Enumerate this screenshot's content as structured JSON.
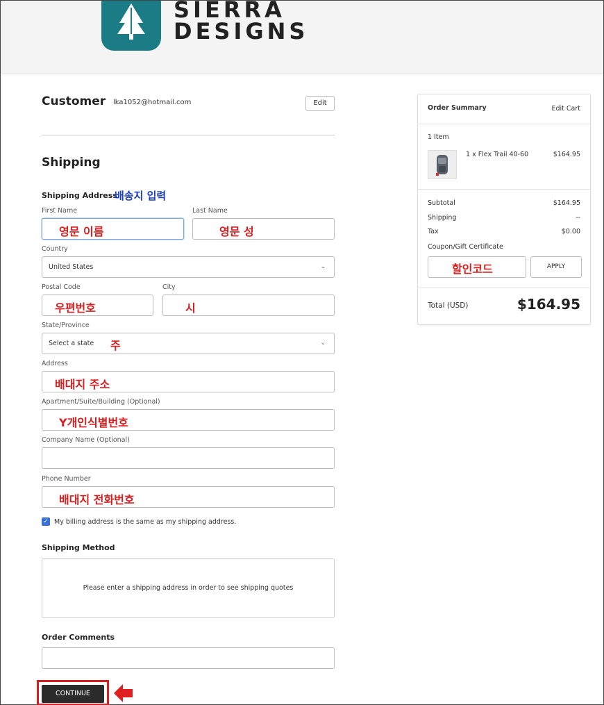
{
  "header": {
    "brand_line1": "SIERRA",
    "brand_line2": "DESIGNS"
  },
  "customer": {
    "title": "Customer",
    "email": "lka1052@hotmail.com",
    "edit_label": "Edit"
  },
  "shipping": {
    "title": "Shipping",
    "address_label": "Shipping Address",
    "address_annotation": "배송지 입력",
    "first_name": {
      "label": "First Name",
      "annotation": "영문 이름"
    },
    "last_name": {
      "label": "Last Name",
      "annotation": "영문 성"
    },
    "country": {
      "label": "Country",
      "value": "United States"
    },
    "postal_code": {
      "label": "Postal Code",
      "annotation": "우편번호"
    },
    "city": {
      "label": "City",
      "annotation": "시"
    },
    "state": {
      "label": "State/Province",
      "value": "Select a state",
      "annotation": "주"
    },
    "address": {
      "label": "Address",
      "annotation": "배대지 주소"
    },
    "apartment": {
      "label": "Apartment/Suite/Building (Optional)",
      "annotation": "Y개인식별번호"
    },
    "company": {
      "label": "Company Name (Optional)"
    },
    "phone": {
      "label": "Phone Number",
      "annotation": "배대지 전화번호"
    },
    "billing_same": "My billing address is the same as my shipping address.",
    "method_title": "Shipping Method",
    "method_text": "Please enter a shipping address in order to see shipping quotes",
    "comments_title": "Order Comments",
    "continue_label": "CONTINUE"
  },
  "summary": {
    "title": "Order Summary",
    "edit_cart": "Edit Cart",
    "item_count": "1 Item",
    "item_name": "1 x Flex Trail 40-60",
    "item_price": "$164.95",
    "subtotal_label": "Subtotal",
    "subtotal_value": "$164.95",
    "shipping_label": "Shipping",
    "shipping_value": "--",
    "tax_label": "Tax",
    "tax_value": "$0.00",
    "coupon_label": "Coupon/Gift Certificate",
    "coupon_annotation": "할인코드",
    "apply_label": "APPLY",
    "total_label": "Total (USD)",
    "total_value": "$164.95"
  },
  "colors": {
    "annotation_red": "#d81e1e",
    "annotation_blue": "#1a3fc0",
    "brand_teal": "#1b7c86"
  }
}
